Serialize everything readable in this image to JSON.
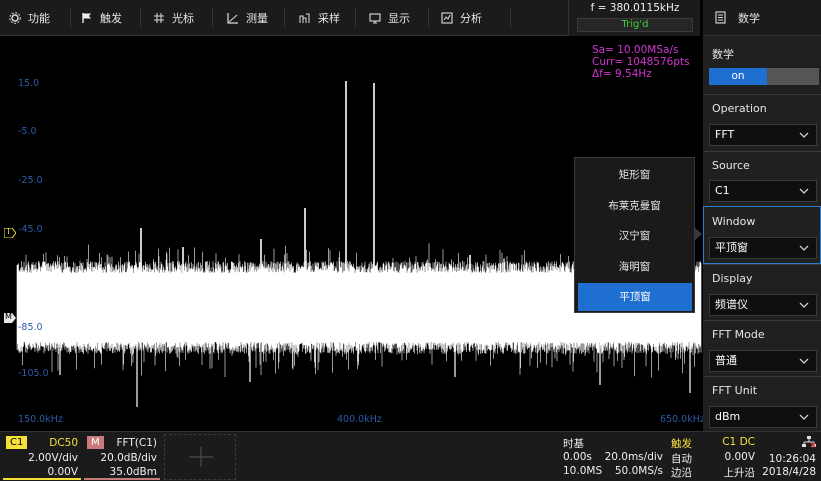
{
  "menu": {
    "items": [
      {
        "label": "功能",
        "icon": "gear-icon"
      },
      {
        "label": "触发",
        "icon": "flag-icon"
      },
      {
        "label": "光标",
        "icon": "cursor-grid-icon"
      },
      {
        "label": "测量",
        "icon": "ruler-icon"
      },
      {
        "label": "采样",
        "icon": "acquire-icon"
      },
      {
        "label": "显示",
        "icon": "display-icon"
      },
      {
        "label": "分析",
        "icon": "analyze-icon"
      }
    ],
    "frequency": "f = 380.0115kHz",
    "trigger_status": "Trig'd"
  },
  "panel": {
    "title": "数学",
    "title_icon": "document-icon",
    "math_label": "数学",
    "toggle_label": "on",
    "operation": {
      "label": "Operation",
      "value": "FFT"
    },
    "source": {
      "label": "Source",
      "value": "C1"
    },
    "window": {
      "label": "Window",
      "value": "平顶窗"
    },
    "display": {
      "label": "Display",
      "value": "频谱仪"
    },
    "fft_mode": {
      "label": "FFT Mode",
      "value": "普通"
    },
    "fft_unit": {
      "label": "FFT Unit",
      "value": "dBm"
    }
  },
  "dropdown": {
    "options": [
      "矩形窗",
      "布莱克曼窗",
      "汉宁窗",
      "海明窗",
      "平顶窗"
    ],
    "selected": "平顶窗"
  },
  "measurements": {
    "sa": "Sa=  10.00MSa/s",
    "curr": "Curr= 1048576pts",
    "df": "Δf=  9.54Hz"
  },
  "axis": {
    "db_labels": [
      "15.0",
      "-5.0",
      "-25.0",
      "-45.0",
      "-85.0",
      "-105.0"
    ],
    "freq_labels": [
      "150.0kHz",
      "400.0kHz",
      "650.0kHz"
    ]
  },
  "markers": {
    "trigger": "T",
    "reference": "M"
  },
  "bottom": {
    "c1": {
      "chip": "C1",
      "coupling": "DC50",
      "scale": "2.00V/div",
      "offset": "0.00V"
    },
    "math": {
      "chip": "M",
      "func": "FFT(C1)",
      "scale": "20.0dB/div",
      "offset": "35.0dBm"
    },
    "timebase": {
      "title": "时基",
      "delay": "0.00s",
      "scale": "20.0ms/div",
      "memory": "10.0MS",
      "rate": "50.0MS/s"
    },
    "trigger": {
      "title": "触发",
      "source": "C1 DC",
      "mode": "自动",
      "level": "0.00V",
      "type": "边沿",
      "slope": "上升沿"
    },
    "clock": {
      "time": "10:26:04",
      "date": "2018/4/28"
    }
  },
  "colors": {
    "c1": "#f5e13a",
    "math": "#c97b7b",
    "accent": "#1e6fd0",
    "trace": "#ffffff",
    "meas": "#d235d2",
    "grid_label": "#2b5aa8",
    "trig_ok": "#3ad03a"
  }
}
